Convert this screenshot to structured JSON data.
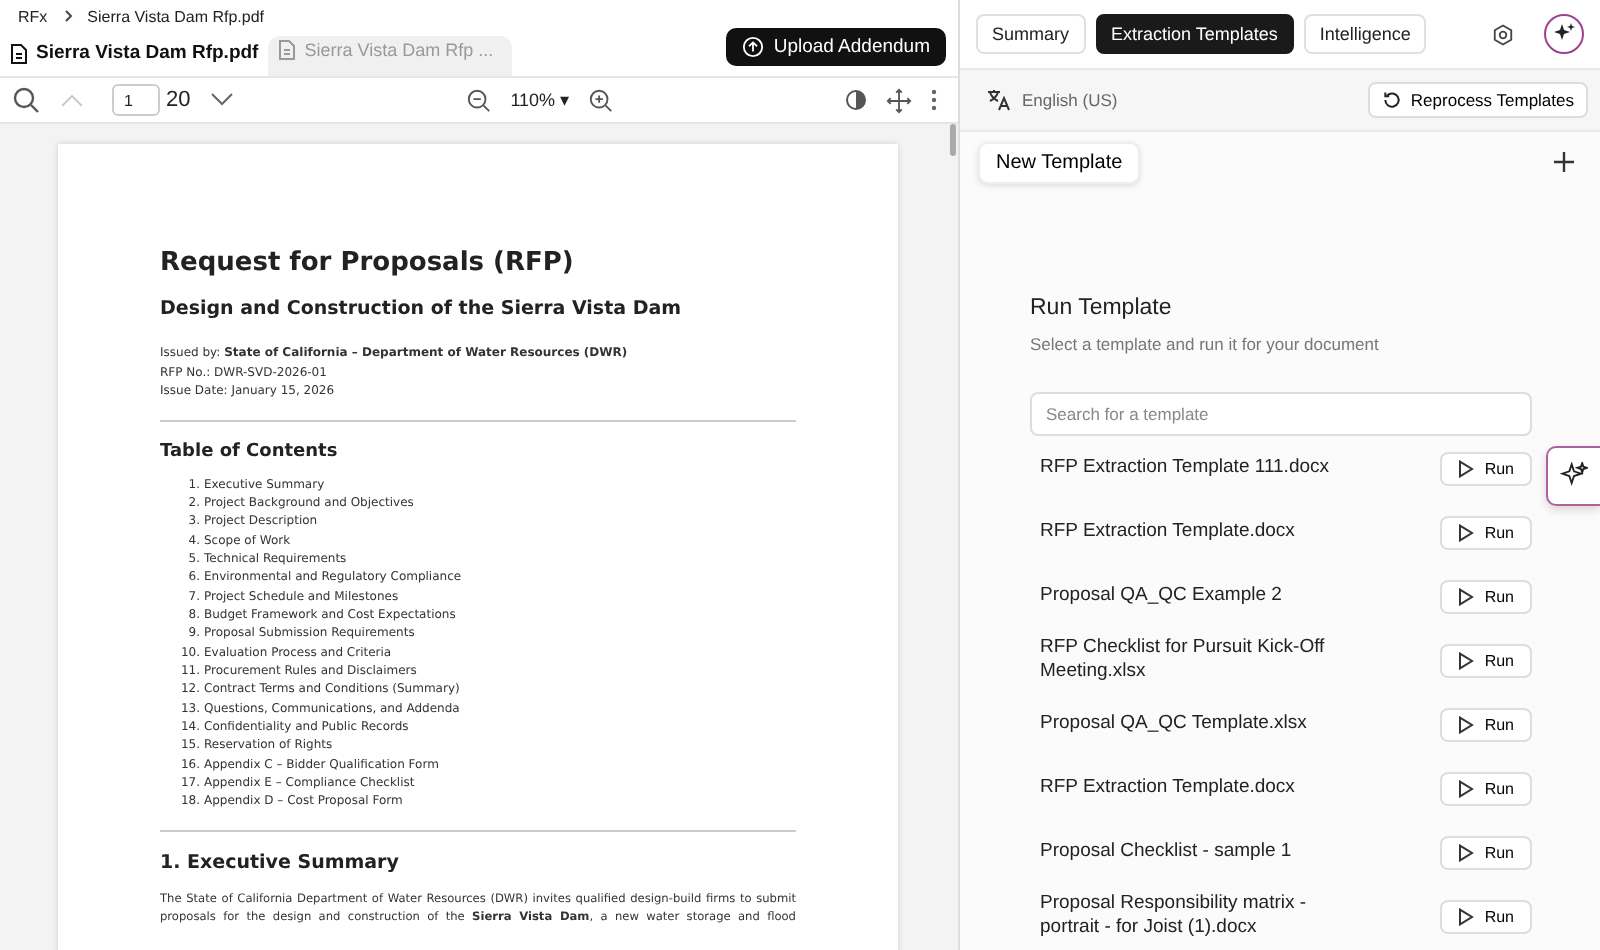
{
  "breadcrumb": [
    "RFx",
    "Sierra Vista Dam Rfp.pdf"
  ],
  "file_tabs": [
    {
      "label": "Sierra Vista Dam Rfp.pdf",
      "selected": true
    },
    {
      "label": "Sierra Vista Dam Rfp ...",
      "selected": false
    }
  ],
  "upload_button": "Upload Addendum",
  "viewer_toolbar": {
    "page": "1",
    "page_count": "20",
    "zoom": "110%",
    "zoom_caret": "▾"
  },
  "document": {
    "title": "Request for Proposals (RFP)",
    "subtitle": "Design and Construction of the Sierra Vista Dam",
    "meta": [
      "Issued by: **State of California – Department of Water Resources (DWR)**",
      "RFP No.: DWR-SVD-2026-01",
      "Issue Date: January 15, 2026"
    ],
    "toc_heading": "Table of Contents",
    "toc": [
      {
        "number": "1.",
        "title": "Executive Summary"
      },
      {
        "number": "2.",
        "title": "Project Background and Objectives"
      },
      {
        "number": "3.",
        "title": "Project Description"
      },
      {
        "number": "4.",
        "title": "Scope of Work"
      },
      {
        "number": "5.",
        "title": "Technical Requirements"
      },
      {
        "number": "6.",
        "title": "Environmental and Regulatory Compliance"
      },
      {
        "number": "7.",
        "title": "Project Schedule and Milestones"
      },
      {
        "number": "8.",
        "title": "Budget Framework and Cost Expectations"
      },
      {
        "number": "9.",
        "title": "Proposal Submission Requirements"
      },
      {
        "number": "10.",
        "title": "Evaluation Process and Criteria"
      },
      {
        "number": "11.",
        "title": "Procurement Rules and Disclaimers"
      },
      {
        "number": "12.",
        "title": "Contract Terms and Conditions (Summary)"
      },
      {
        "number": "13.",
        "title": "Questions, Communications, and Addenda"
      },
      {
        "number": "14.",
        "title": "Confidentiality and Public Records"
      },
      {
        "number": "15.",
        "title": "Reservation of Rights"
      },
      {
        "number": "16.",
        "title": "Appendix C – Bidder Qualification Form"
      },
      {
        "number": "17.",
        "title": "Appendix E – Compliance Checklist"
      },
      {
        "number": "18.",
        "title": "Appendix D – Cost Proposal Form"
      }
    ],
    "section_heading": "1. Executive Summary",
    "section_text": "The State of California Department of Water Resources (DWR) invites qualified design-build firms to submit proposals for the design and construction of the **Sierra Vista Dam**, a new water storage and flood"
  },
  "panel_tabs": [
    {
      "label": "Summary",
      "selected": false
    },
    {
      "label": "Extraction Templates",
      "selected": true
    },
    {
      "label": "Intelligence",
      "selected": false
    }
  ],
  "language": "English (US)",
  "reprocess_button": "Reprocess Templates",
  "new_template_tab": "New Template",
  "run_template": {
    "title": "Run Template",
    "subtitle": "Select a template and run it for your document",
    "search_placeholder": "Search for a template",
    "templates": [
      {
        "name": "RFP Extraction Template 111.docx",
        "run_label": "Run"
      },
      {
        "name": "RFP Extraction Template.docx",
        "run_label": "Run"
      },
      {
        "name": "Proposal QA_QC Example 2",
        "run_label": "Run"
      },
      {
        "name": "RFP Checklist for Pursuit Kick-Off Meeting.xlsx",
        "run_label": "Run"
      },
      {
        "name": "Proposal QA_QC Template.xlsx",
        "run_label": "Run"
      },
      {
        "name": "RFP Extraction Template.docx",
        "run_label": "Run"
      },
      {
        "name": "Proposal Checklist - sample 1",
        "run_label": "Run"
      },
      {
        "name": "Proposal Responsibility matrix - portrait - for Joist (1).docx",
        "run_label": "Run"
      }
    ]
  }
}
